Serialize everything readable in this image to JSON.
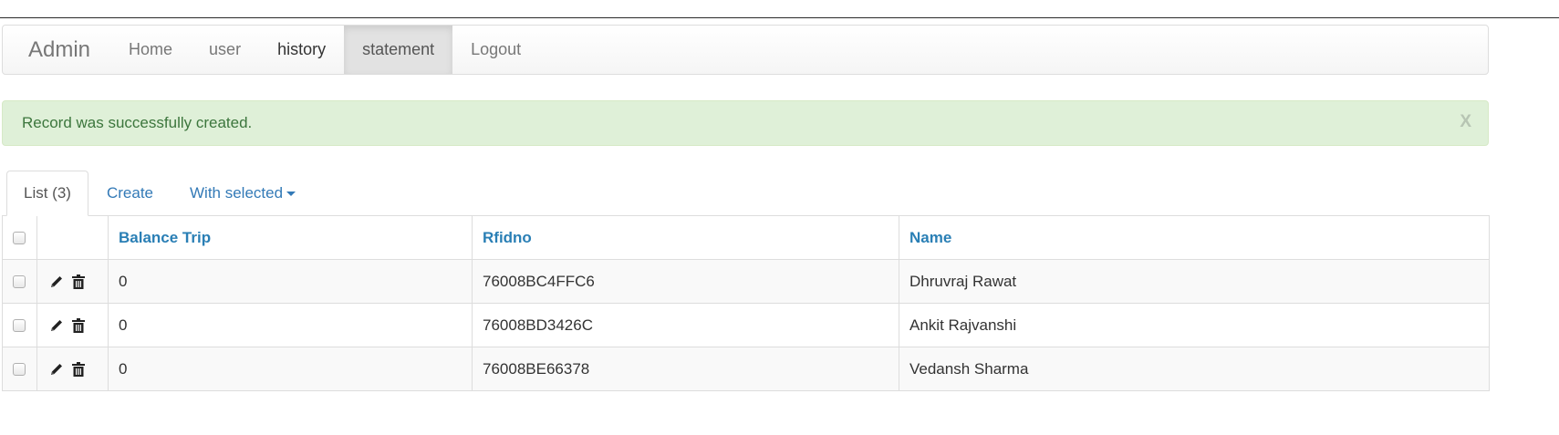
{
  "navbar": {
    "brand": "Admin",
    "links": [
      {
        "label": "Home"
      },
      {
        "label": "user"
      },
      {
        "label": "history"
      },
      {
        "label": "statement"
      },
      {
        "label": "Logout"
      }
    ]
  },
  "alert": {
    "message": "Record was successfully created.",
    "close_label": "X"
  },
  "tabs": {
    "list": "List (3)",
    "create": "Create",
    "with_selected": "With selected"
  },
  "table": {
    "headers": {
      "balance_trip": "Balance Trip",
      "rfidno": "Rfidno",
      "name": "Name"
    },
    "rows": [
      {
        "balance_trip": "0",
        "rfidno": "76008BC4FFC6",
        "name": "Dhruvraj Rawat"
      },
      {
        "balance_trip": "0",
        "rfidno": "76008BD3426C",
        "name": "Ankit Rajvanshi"
      },
      {
        "balance_trip": "0",
        "rfidno": "76008BE66378",
        "name": "Vedansh Sharma"
      }
    ],
    "row_icons": [
      "pencil-icon",
      "trash-icon"
    ]
  },
  "colors": {
    "link": "#337ab7",
    "alert_bg": "#dff0d8",
    "alert_text": "#3c763d",
    "active_nav": "#e2e2e2"
  }
}
